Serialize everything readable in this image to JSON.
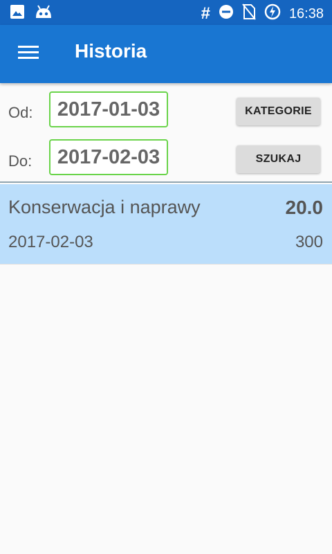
{
  "status_bar": {
    "time": "16:38",
    "hash": "#",
    "icons": [
      "image-icon",
      "android-icon",
      "dnd-icon",
      "no-sim-icon",
      "battery-charging-icon"
    ]
  },
  "app_bar": {
    "title": "Historia",
    "menu_icon": "menu-icon"
  },
  "filters": {
    "from_label": "Od:",
    "from_date": "2017-01-03",
    "to_label": "Do:",
    "to_date": "2017-02-03",
    "categories_button": "KATEGORIE",
    "search_button": "SZUKAJ"
  },
  "history": [
    {
      "category": "Konserwacja i naprawy",
      "amount": "20.0",
      "date": "2017-02-03",
      "value": "300"
    }
  ],
  "colors": {
    "status_bar": "#1565c0",
    "app_bar": "#1976d2",
    "item_bg": "#bbdefb",
    "date_border": "#6ad44a"
  }
}
